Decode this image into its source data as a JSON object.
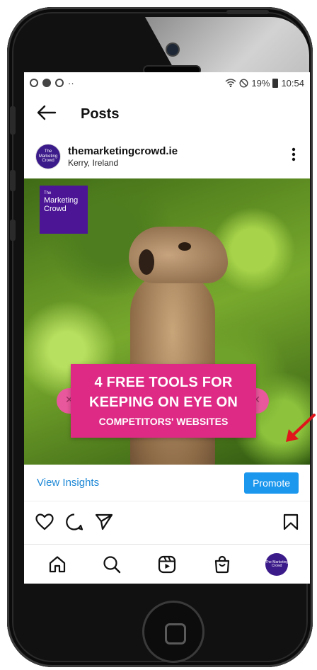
{
  "status_bar": {
    "more_indicator": "··",
    "battery": "19%",
    "time": "10:54"
  },
  "header": {
    "title": "Posts"
  },
  "post": {
    "username": "themarketingcrowd.ie",
    "location": "Kerry, Ireland",
    "avatar_text": "The Marketing Crowd",
    "image": {
      "brand_small": "The",
      "brand_name": "Marketing Crowd",
      "headline_line1": "4 FREE TOOLS FOR",
      "headline_line2": "KEEPING ON EYE ON",
      "headline_line3": "COMPETITORS' WEBSITES"
    },
    "view_insights_label": "View Insights",
    "promote_label": "Promote"
  },
  "tabbar": {
    "items": [
      "home",
      "search",
      "reels",
      "shop",
      "profile"
    ],
    "profile_avatar_text": "The Marketing Crowd"
  },
  "colors": {
    "accent_blue": "#1c97ee",
    "link_blue": "#1e88d6",
    "promo_pink": "#de2a85",
    "brand_purple": "#4b1596",
    "annotation_red": "#e0141b"
  }
}
